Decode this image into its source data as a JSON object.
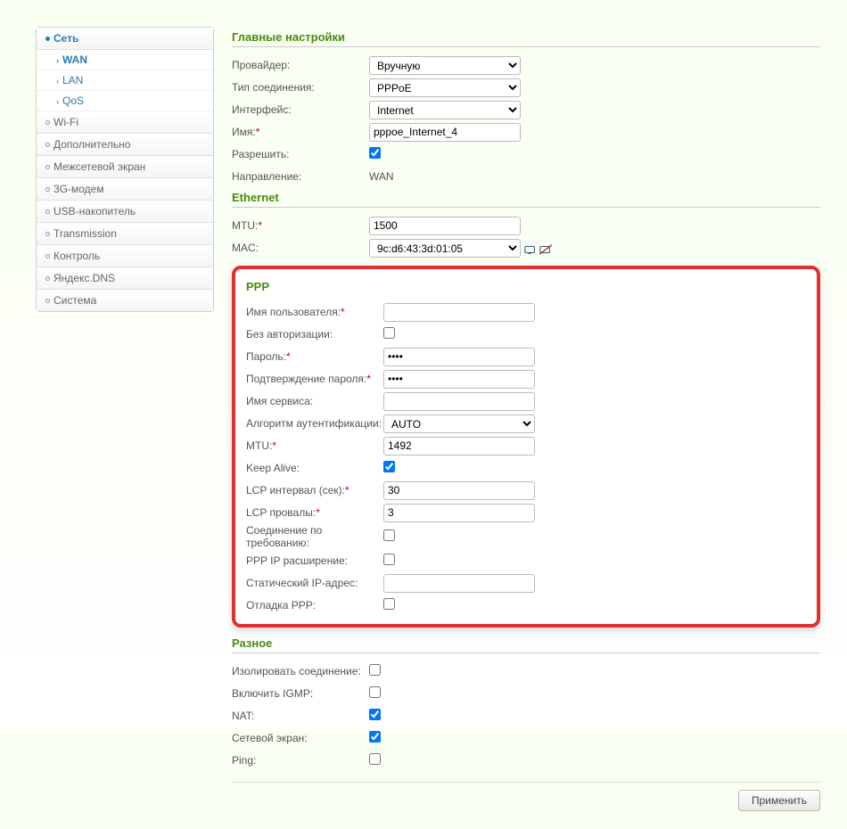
{
  "sidebar": {
    "items": [
      {
        "label": "Сеть",
        "expanded": true,
        "children": [
          {
            "label": "WAN",
            "active": true
          },
          {
            "label": "LAN",
            "active": false
          },
          {
            "label": "QoS",
            "active": false
          }
        ]
      },
      {
        "label": "Wi-Fi"
      },
      {
        "label": "Дополнительно"
      },
      {
        "label": "Межсетевой экран"
      },
      {
        "label": "3G-модем"
      },
      {
        "label": "USB-накопитель"
      },
      {
        "label": "Transmission"
      },
      {
        "label": "Контроль"
      },
      {
        "label": "Яндекс.DNS"
      },
      {
        "label": "Система"
      }
    ]
  },
  "sections": {
    "main": {
      "title": "Главные настройки",
      "provider_label": "Провайдер:",
      "provider_value": "Вручную",
      "conn_type_label": "Тип соединения:",
      "conn_type_value": "PPPoE",
      "interface_label": "Интерфейс:",
      "interface_value": "Internet",
      "name_label": "Имя:",
      "name_value": "pppoe_Internet_4",
      "allow_label": "Разрешить:",
      "allow_checked": true,
      "direction_label": "Направление:",
      "direction_value": "WAN"
    },
    "ethernet": {
      "title": "Ethernet",
      "mtu_label": "MTU:",
      "mtu_value": "1500",
      "mac_label": "MAC:",
      "mac_value": "9c:d6:43:3d:01:05"
    },
    "ppp": {
      "title": "PPP",
      "username_label": "Имя пользователя:",
      "username_value": "",
      "noauth_label": "Без авторизации:",
      "noauth_checked": false,
      "password_label": "Пароль:",
      "password_value": "••••",
      "password_confirm_label": "Подтверждение пароля:",
      "password_confirm_value": "••••",
      "service_label": "Имя сервиса:",
      "service_value": "",
      "auth_algo_label": "Алгоритм аутентификации:",
      "auth_algo_value": "AUTO",
      "mtu_label": "MTU:",
      "mtu_value": "1492",
      "keepalive_label": "Keep Alive:",
      "keepalive_checked": true,
      "lcp_interval_label": "LCP интервал (сек):",
      "lcp_interval_value": "30",
      "lcp_fail_label": "LCP провалы:",
      "lcp_fail_value": "3",
      "dial_ondemand_label": "Соединение по требованию:",
      "dial_ondemand_checked": false,
      "ppp_ip_ext_label": "PPP IP расширение:",
      "ppp_ip_ext_checked": false,
      "static_ip_label": "Статический IP-адрес:",
      "static_ip_value": "",
      "debug_label": "Отладка PPP:",
      "debug_checked": false
    },
    "misc": {
      "title": "Разное",
      "isolate_label": "Изолировать соединение:",
      "isolate_checked": false,
      "igmp_label": "Включить IGMP:",
      "igmp_checked": false,
      "nat_label": "NAT:",
      "nat_checked": true,
      "firewall_label": "Сетевой экран:",
      "firewall_checked": true,
      "ping_label": "Ping:",
      "ping_checked": false
    }
  },
  "buttons": {
    "apply": "Применить"
  }
}
